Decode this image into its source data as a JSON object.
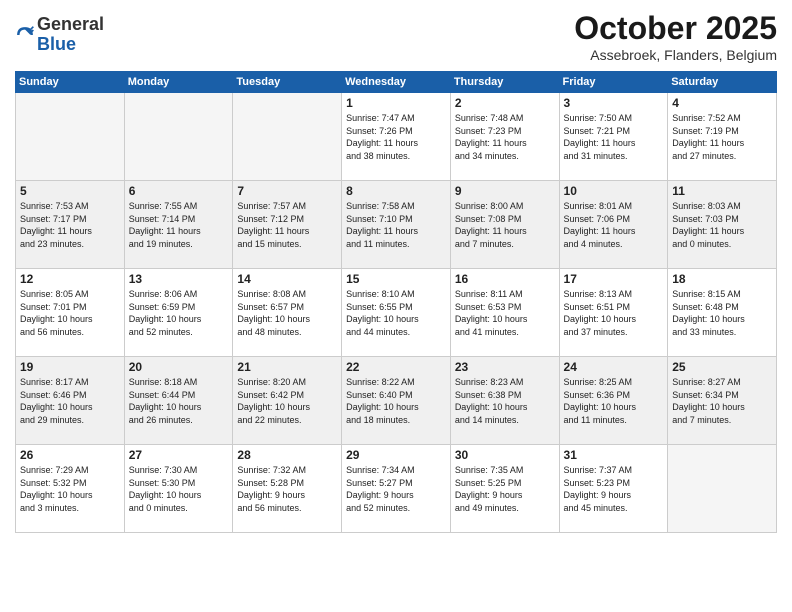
{
  "header": {
    "logo": {
      "line1": "General",
      "line2": "Blue"
    },
    "month": "October 2025",
    "location": "Assebroek, Flanders, Belgium"
  },
  "weekdays": [
    "Sunday",
    "Monday",
    "Tuesday",
    "Wednesday",
    "Thursday",
    "Friday",
    "Saturday"
  ],
  "weeks": [
    {
      "shaded": false,
      "days": [
        {
          "num": "",
          "info": ""
        },
        {
          "num": "",
          "info": ""
        },
        {
          "num": "",
          "info": ""
        },
        {
          "num": "1",
          "info": "Sunrise: 7:47 AM\nSunset: 7:26 PM\nDaylight: 11 hours\nand 38 minutes."
        },
        {
          "num": "2",
          "info": "Sunrise: 7:48 AM\nSunset: 7:23 PM\nDaylight: 11 hours\nand 34 minutes."
        },
        {
          "num": "3",
          "info": "Sunrise: 7:50 AM\nSunset: 7:21 PM\nDaylight: 11 hours\nand 31 minutes."
        },
        {
          "num": "4",
          "info": "Sunrise: 7:52 AM\nSunset: 7:19 PM\nDaylight: 11 hours\nand 27 minutes."
        }
      ]
    },
    {
      "shaded": true,
      "days": [
        {
          "num": "5",
          "info": "Sunrise: 7:53 AM\nSunset: 7:17 PM\nDaylight: 11 hours\nand 23 minutes."
        },
        {
          "num": "6",
          "info": "Sunrise: 7:55 AM\nSunset: 7:14 PM\nDaylight: 11 hours\nand 19 minutes."
        },
        {
          "num": "7",
          "info": "Sunrise: 7:57 AM\nSunset: 7:12 PM\nDaylight: 11 hours\nand 15 minutes."
        },
        {
          "num": "8",
          "info": "Sunrise: 7:58 AM\nSunset: 7:10 PM\nDaylight: 11 hours\nand 11 minutes."
        },
        {
          "num": "9",
          "info": "Sunrise: 8:00 AM\nSunset: 7:08 PM\nDaylight: 11 hours\nand 7 minutes."
        },
        {
          "num": "10",
          "info": "Sunrise: 8:01 AM\nSunset: 7:06 PM\nDaylight: 11 hours\nand 4 minutes."
        },
        {
          "num": "11",
          "info": "Sunrise: 8:03 AM\nSunset: 7:03 PM\nDaylight: 11 hours\nand 0 minutes."
        }
      ]
    },
    {
      "shaded": false,
      "days": [
        {
          "num": "12",
          "info": "Sunrise: 8:05 AM\nSunset: 7:01 PM\nDaylight: 10 hours\nand 56 minutes."
        },
        {
          "num": "13",
          "info": "Sunrise: 8:06 AM\nSunset: 6:59 PM\nDaylight: 10 hours\nand 52 minutes."
        },
        {
          "num": "14",
          "info": "Sunrise: 8:08 AM\nSunset: 6:57 PM\nDaylight: 10 hours\nand 48 minutes."
        },
        {
          "num": "15",
          "info": "Sunrise: 8:10 AM\nSunset: 6:55 PM\nDaylight: 10 hours\nand 44 minutes."
        },
        {
          "num": "16",
          "info": "Sunrise: 8:11 AM\nSunset: 6:53 PM\nDaylight: 10 hours\nand 41 minutes."
        },
        {
          "num": "17",
          "info": "Sunrise: 8:13 AM\nSunset: 6:51 PM\nDaylight: 10 hours\nand 37 minutes."
        },
        {
          "num": "18",
          "info": "Sunrise: 8:15 AM\nSunset: 6:48 PM\nDaylight: 10 hours\nand 33 minutes."
        }
      ]
    },
    {
      "shaded": true,
      "days": [
        {
          "num": "19",
          "info": "Sunrise: 8:17 AM\nSunset: 6:46 PM\nDaylight: 10 hours\nand 29 minutes."
        },
        {
          "num": "20",
          "info": "Sunrise: 8:18 AM\nSunset: 6:44 PM\nDaylight: 10 hours\nand 26 minutes."
        },
        {
          "num": "21",
          "info": "Sunrise: 8:20 AM\nSunset: 6:42 PM\nDaylight: 10 hours\nand 22 minutes."
        },
        {
          "num": "22",
          "info": "Sunrise: 8:22 AM\nSunset: 6:40 PM\nDaylight: 10 hours\nand 18 minutes."
        },
        {
          "num": "23",
          "info": "Sunrise: 8:23 AM\nSunset: 6:38 PM\nDaylight: 10 hours\nand 14 minutes."
        },
        {
          "num": "24",
          "info": "Sunrise: 8:25 AM\nSunset: 6:36 PM\nDaylight: 10 hours\nand 11 minutes."
        },
        {
          "num": "25",
          "info": "Sunrise: 8:27 AM\nSunset: 6:34 PM\nDaylight: 10 hours\nand 7 minutes."
        }
      ]
    },
    {
      "shaded": false,
      "days": [
        {
          "num": "26",
          "info": "Sunrise: 7:29 AM\nSunset: 5:32 PM\nDaylight: 10 hours\nand 3 minutes."
        },
        {
          "num": "27",
          "info": "Sunrise: 7:30 AM\nSunset: 5:30 PM\nDaylight: 10 hours\nand 0 minutes."
        },
        {
          "num": "28",
          "info": "Sunrise: 7:32 AM\nSunset: 5:28 PM\nDaylight: 9 hours\nand 56 minutes."
        },
        {
          "num": "29",
          "info": "Sunrise: 7:34 AM\nSunset: 5:27 PM\nDaylight: 9 hours\nand 52 minutes."
        },
        {
          "num": "30",
          "info": "Sunrise: 7:35 AM\nSunset: 5:25 PM\nDaylight: 9 hours\nand 49 minutes."
        },
        {
          "num": "31",
          "info": "Sunrise: 7:37 AM\nSunset: 5:23 PM\nDaylight: 9 hours\nand 45 minutes."
        },
        {
          "num": "",
          "info": ""
        }
      ]
    }
  ]
}
